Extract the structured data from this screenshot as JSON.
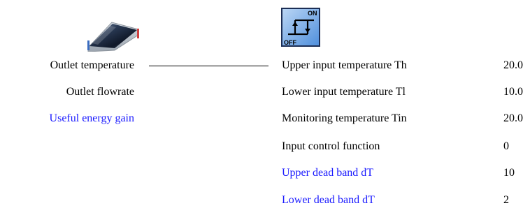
{
  "colors": {
    "text": "#000000",
    "link_blue": "#1a1aff",
    "background": "#ffffff"
  },
  "components": {
    "collector": {
      "icon": "solar-collector-icon"
    },
    "controller": {
      "icon": "on-off-controller-icon",
      "on_label": "ON",
      "off_label": "OFF"
    }
  },
  "outputs": [
    {
      "label": "Outlet temperature",
      "color": "#000000"
    },
    {
      "label": "Outlet flowrate",
      "color": "#000000"
    },
    {
      "label": "Useful energy gain",
      "color": "#1a1aff"
    }
  ],
  "inputs": [
    {
      "label": "Upper input temperature Th",
      "value": "20.0",
      "color": "#000000"
    },
    {
      "label": "Lower input temperature Tl",
      "value": "10.0",
      "color": "#000000"
    },
    {
      "label": "Monitoring temperature Tin",
      "value": "20.0",
      "color": "#000000"
    },
    {
      "label": "Input control function",
      "value": "0",
      "color": "#000000"
    },
    {
      "label": "Upper dead band dT",
      "value": "10",
      "color": "#1a1aff"
    },
    {
      "label": "Lower dead band dT",
      "value": "2",
      "color": "#1a1aff"
    }
  ]
}
